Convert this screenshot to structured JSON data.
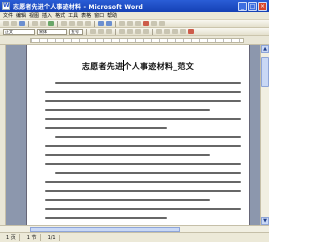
{
  "window": {
    "title": "志愿者先进个人事迹材料 - Microsoft Word",
    "minimize": "_",
    "maximize": "□",
    "close": "×"
  },
  "menu": [
    "文件",
    "编辑",
    "视图",
    "插入",
    "格式",
    "工具",
    "表格",
    "窗口",
    "帮助"
  ],
  "toolbar": {
    "style_value": "正文",
    "font_value": "宋体",
    "size_value": "五号"
  },
  "document": {
    "title": "志愿者先进个人事迹材料_范文"
  },
  "status": {
    "page": "1 页",
    "section": "1 节",
    "page_count": "1/1"
  }
}
